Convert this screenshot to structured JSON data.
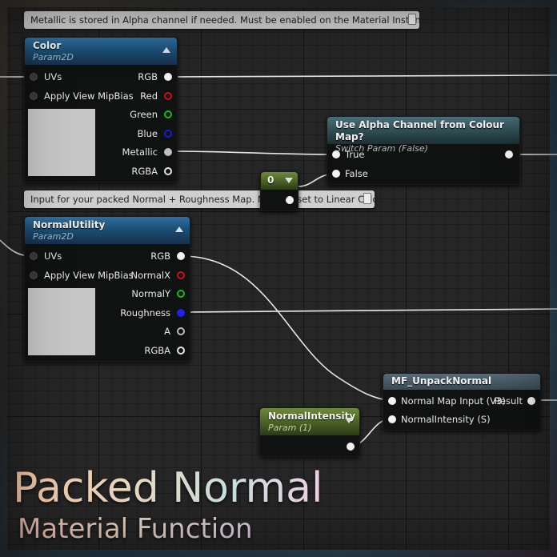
{
  "comments": {
    "metallic": "Metallic is stored in Alpha channel if needed. Must be enabled on the Material Instance.",
    "normal": "Input for your packed Normal + Roughness Map. Must be set to Linear Color."
  },
  "color_node": {
    "title": "Color",
    "subtitle": "Param2D",
    "inputs": [
      "UVs",
      "Apply View MipBias"
    ],
    "outputs": [
      "RGB",
      "Red",
      "Green",
      "Blue",
      "Metallic",
      "RGBA"
    ]
  },
  "switch_node": {
    "title": "Use Alpha Channel from Colour Map?",
    "subtitle": "Switch Param (False)",
    "inputs": [
      "True",
      "False"
    ]
  },
  "constant_node": {
    "value": "0"
  },
  "normal_node": {
    "title": "NormalUtility",
    "subtitle": "Param2D",
    "inputs": [
      "UVs",
      "Apply View MipBias"
    ],
    "outputs": [
      "RGB",
      "NormalX",
      "NormalY",
      "Roughness",
      "A",
      "RGBA"
    ]
  },
  "unpack_node": {
    "title": "MF_UnpackNormal",
    "inputs": [
      "Normal Map Input (V3)",
      "NormalIntensity (S)"
    ],
    "output": "Result"
  },
  "intensity_node": {
    "title": "NormalIntensity",
    "subtitle": "Param (1)"
  },
  "overlay": {
    "title": "Packed Normal",
    "subtitle": "Material Function"
  },
  "colors": {
    "pin_red": "#d01010",
    "pin_green": "#10c010",
    "pin_blue": "#1a1ad0",
    "wire": "#e6e6e6"
  }
}
